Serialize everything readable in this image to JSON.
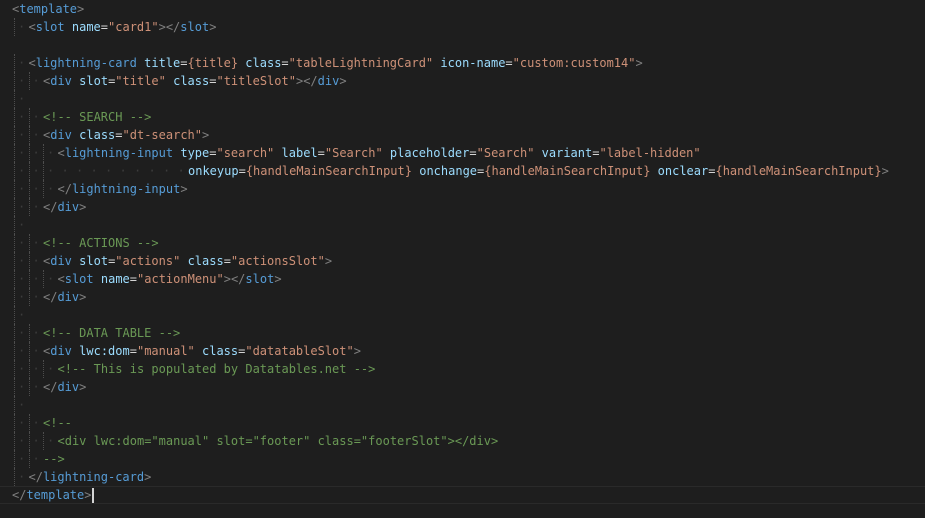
{
  "editor": {
    "language": "html",
    "current_line": 28,
    "colors": {
      "background": "#1e1e1e",
      "bracket": "#808080",
      "tag": "#569cd6",
      "attribute": "#9cdcfe",
      "string": "#ce9178",
      "comment": "#6a9955",
      "text": "#d4d4d4"
    },
    "lines": [
      {
        "indent": 0,
        "tokens": [
          [
            "bracket",
            "<"
          ],
          [
            "tag",
            "template"
          ],
          [
            "bracket",
            ">"
          ]
        ]
      },
      {
        "indent": 1,
        "tokens": [
          [
            "bracket",
            "<"
          ],
          [
            "tag",
            "slot"
          ],
          [
            "text",
            " "
          ],
          [
            "attr",
            "name"
          ],
          [
            "eq",
            "="
          ],
          [
            "str",
            "\"card1\""
          ],
          [
            "bracket",
            ">"
          ],
          [
            "bracket",
            "</"
          ],
          [
            "tag",
            "slot"
          ],
          [
            "bracket",
            ">"
          ]
        ]
      },
      {
        "indent": 0,
        "tokens": []
      },
      {
        "indent": 1,
        "tokens": [
          [
            "bracket",
            "<"
          ],
          [
            "tag",
            "lightning-card"
          ],
          [
            "text",
            " "
          ],
          [
            "attr",
            "title"
          ],
          [
            "eq",
            "="
          ],
          [
            "str",
            "{title}"
          ],
          [
            "text",
            " "
          ],
          [
            "attr",
            "class"
          ],
          [
            "eq",
            "="
          ],
          [
            "str",
            "\"tableLightningCard\""
          ],
          [
            "text",
            " "
          ],
          [
            "attr",
            "icon-name"
          ],
          [
            "eq",
            "="
          ],
          [
            "str",
            "\"custom:custom14\""
          ],
          [
            "bracket",
            ">"
          ]
        ]
      },
      {
        "indent": 2,
        "tokens": [
          [
            "bracket",
            "<"
          ],
          [
            "tag",
            "div"
          ],
          [
            "text",
            " "
          ],
          [
            "attr",
            "slot"
          ],
          [
            "eq",
            "="
          ],
          [
            "str",
            "\"title\""
          ],
          [
            "text",
            " "
          ],
          [
            "attr",
            "class"
          ],
          [
            "eq",
            "="
          ],
          [
            "str",
            "\"titleSlot\""
          ],
          [
            "bracket",
            ">"
          ],
          [
            "bracket",
            "</"
          ],
          [
            "tag",
            "div"
          ],
          [
            "bracket",
            ">"
          ]
        ]
      },
      {
        "indent": 1,
        "tokens": []
      },
      {
        "indent": 2,
        "tokens": [
          [
            "comment",
            "<!-- SEARCH -->"
          ]
        ]
      },
      {
        "indent": 2,
        "tokens": [
          [
            "bracket",
            "<"
          ],
          [
            "tag",
            "div"
          ],
          [
            "text",
            " "
          ],
          [
            "attr",
            "class"
          ],
          [
            "eq",
            "="
          ],
          [
            "str",
            "\"dt-search\""
          ],
          [
            "bracket",
            ">"
          ]
        ]
      },
      {
        "indent": 3,
        "tokens": [
          [
            "bracket",
            "<"
          ],
          [
            "tag",
            "lightning-input"
          ],
          [
            "text",
            " "
          ],
          [
            "attr",
            "type"
          ],
          [
            "eq",
            "="
          ],
          [
            "str",
            "\"search\""
          ],
          [
            "text",
            " "
          ],
          [
            "attr",
            "label"
          ],
          [
            "eq",
            "="
          ],
          [
            "str",
            "\"Search\""
          ],
          [
            "text",
            " "
          ],
          [
            "attr",
            "placeholder"
          ],
          [
            "eq",
            "="
          ],
          [
            "str",
            "\"Search\""
          ],
          [
            "text",
            " "
          ],
          [
            "attr",
            "variant"
          ],
          [
            "eq",
            "="
          ],
          [
            "str",
            "\"label-hidden\""
          ]
        ]
      },
      {
        "indent": 12,
        "tokens": [
          [
            "attr",
            "onkeyup"
          ],
          [
            "eq",
            "="
          ],
          [
            "str",
            "{handleMainSearchInput}"
          ],
          [
            "text",
            " "
          ],
          [
            "attr",
            "onchange"
          ],
          [
            "eq",
            "="
          ],
          [
            "str",
            "{handleMainSearchInput}"
          ],
          [
            "text",
            " "
          ],
          [
            "attr",
            "onclear"
          ],
          [
            "eq",
            "="
          ],
          [
            "str",
            "{handleMainSearchInput}"
          ],
          [
            "bracket",
            ">"
          ]
        ]
      },
      {
        "indent": 3,
        "tokens": [
          [
            "bracket",
            "</"
          ],
          [
            "tag",
            "lightning-input"
          ],
          [
            "bracket",
            ">"
          ]
        ]
      },
      {
        "indent": 2,
        "tokens": [
          [
            "bracket",
            "</"
          ],
          [
            "tag",
            "div"
          ],
          [
            "bracket",
            ">"
          ]
        ]
      },
      {
        "indent": 1,
        "tokens": []
      },
      {
        "indent": 2,
        "tokens": [
          [
            "comment",
            "<!-- ACTIONS -->"
          ]
        ]
      },
      {
        "indent": 2,
        "tokens": [
          [
            "bracket",
            "<"
          ],
          [
            "tag",
            "div"
          ],
          [
            "text",
            " "
          ],
          [
            "attr",
            "slot"
          ],
          [
            "eq",
            "="
          ],
          [
            "str",
            "\"actions\""
          ],
          [
            "text",
            " "
          ],
          [
            "attr",
            "class"
          ],
          [
            "eq",
            "="
          ],
          [
            "str",
            "\"actionsSlot\""
          ],
          [
            "bracket",
            ">"
          ]
        ]
      },
      {
        "indent": 3,
        "tokens": [
          [
            "bracket",
            "<"
          ],
          [
            "tag",
            "slot"
          ],
          [
            "text",
            " "
          ],
          [
            "attr",
            "name"
          ],
          [
            "eq",
            "="
          ],
          [
            "str",
            "\"actionMenu\""
          ],
          [
            "bracket",
            ">"
          ],
          [
            "bracket",
            "</"
          ],
          [
            "tag",
            "slot"
          ],
          [
            "bracket",
            ">"
          ]
        ]
      },
      {
        "indent": 2,
        "tokens": [
          [
            "bracket",
            "</"
          ],
          [
            "tag",
            "div"
          ],
          [
            "bracket",
            ">"
          ]
        ]
      },
      {
        "indent": 1,
        "tokens": []
      },
      {
        "indent": 2,
        "tokens": [
          [
            "comment",
            "<!-- DATA TABLE -->"
          ]
        ]
      },
      {
        "indent": 2,
        "tokens": [
          [
            "bracket",
            "<"
          ],
          [
            "tag",
            "div"
          ],
          [
            "text",
            " "
          ],
          [
            "attr",
            "lwc:dom"
          ],
          [
            "eq",
            "="
          ],
          [
            "str",
            "\"manual\""
          ],
          [
            "text",
            " "
          ],
          [
            "attr",
            "class"
          ],
          [
            "eq",
            "="
          ],
          [
            "str",
            "\"datatableSlot\""
          ],
          [
            "bracket",
            ">"
          ]
        ]
      },
      {
        "indent": 3,
        "tokens": [
          [
            "comment",
            "<!-- This is populated by Datatables.net -->"
          ]
        ]
      },
      {
        "indent": 2,
        "tokens": [
          [
            "bracket",
            "</"
          ],
          [
            "tag",
            "div"
          ],
          [
            "bracket",
            ">"
          ]
        ]
      },
      {
        "indent": 1,
        "tokens": []
      },
      {
        "indent": 2,
        "tokens": [
          [
            "comment",
            "<!--"
          ]
        ]
      },
      {
        "indent": 3,
        "tokens": [
          [
            "comment",
            "<div lwc:dom=\"manual\" slot=\"footer\" class=\"footerSlot\"></div>"
          ]
        ]
      },
      {
        "indent": 2,
        "tokens": [
          [
            "comment",
            "-->"
          ]
        ]
      },
      {
        "indent": 1,
        "tokens": [
          [
            "bracket",
            "</"
          ],
          [
            "tag",
            "lightning-card"
          ],
          [
            "bracket",
            ">"
          ]
        ]
      },
      {
        "indent": 0,
        "tokens": [
          [
            "bracket",
            "</"
          ],
          [
            "tag",
            "template"
          ],
          [
            "bracket",
            ">"
          ]
        ]
      }
    ]
  }
}
